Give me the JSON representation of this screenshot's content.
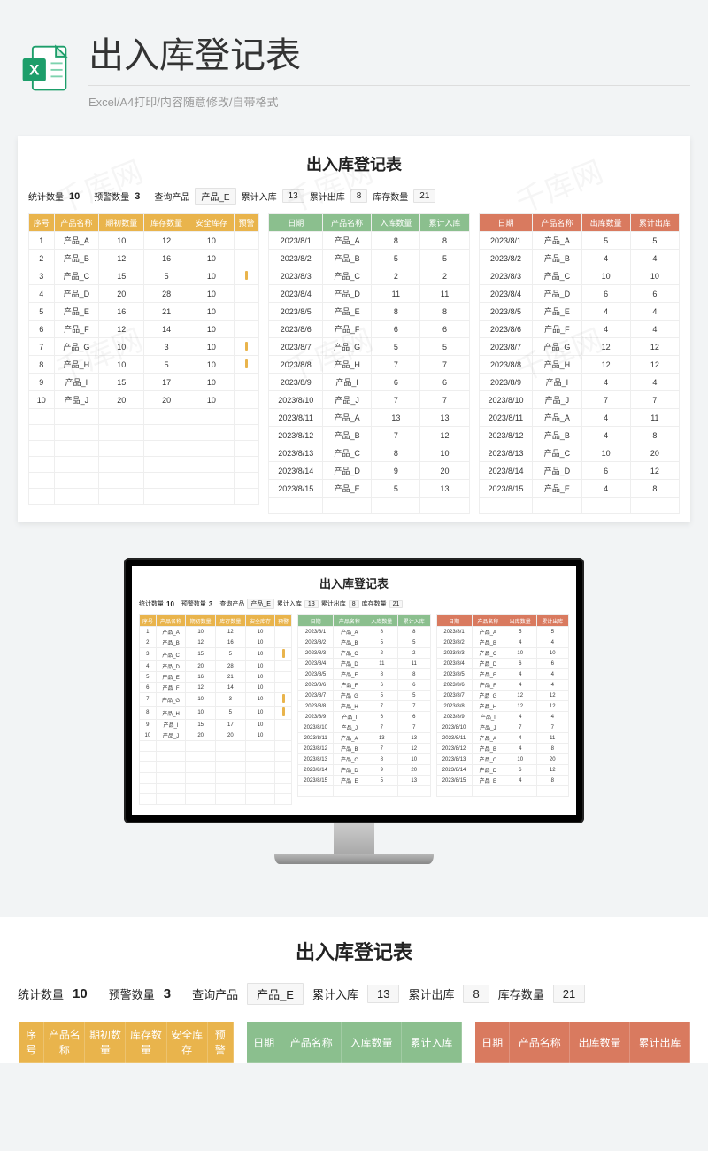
{
  "page": {
    "title": "出入库登记表",
    "subtitle": "Excel/A4打印/内容随意修改/自带格式",
    "watermark": "千库网"
  },
  "sheet": {
    "title": "出入库登记表",
    "stats": {
      "count_label": "统计数量",
      "count_val": "10",
      "warn_label": "预警数量",
      "warn_val": "3",
      "query_label": "查询产品",
      "query_val": "产品_E",
      "in_label": "累计入库",
      "in_val": "13",
      "out_label": "累计出库",
      "out_val": "8",
      "stock_label": "库存数量",
      "stock_val": "21"
    },
    "t1_headers": [
      "序号",
      "产品名称",
      "期初数量",
      "库存数量",
      "安全库存",
      "预警"
    ],
    "t2_headers": [
      "日期",
      "产品名称",
      "入库数量",
      "累计入库"
    ],
    "t3_headers": [
      "日期",
      "产品名称",
      "出库数量",
      "累计出库"
    ],
    "t1_rows": [
      [
        "1",
        "产品_A",
        "10",
        "12",
        "10",
        ""
      ],
      [
        "2",
        "产品_B",
        "12",
        "16",
        "10",
        ""
      ],
      [
        "3",
        "产品_C",
        "15",
        "5",
        "10",
        "!"
      ],
      [
        "4",
        "产品_D",
        "20",
        "28",
        "10",
        ""
      ],
      [
        "5",
        "产品_E",
        "16",
        "21",
        "10",
        ""
      ],
      [
        "6",
        "产品_F",
        "12",
        "14",
        "10",
        ""
      ],
      [
        "7",
        "产品_G",
        "10",
        "3",
        "10",
        "!"
      ],
      [
        "8",
        "产品_H",
        "10",
        "5",
        "10",
        "!"
      ],
      [
        "9",
        "产品_I",
        "15",
        "17",
        "10",
        ""
      ],
      [
        "10",
        "产品_J",
        "20",
        "20",
        "10",
        ""
      ]
    ],
    "t2_rows": [
      [
        "2023/8/1",
        "产品_A",
        "8",
        "8"
      ],
      [
        "2023/8/2",
        "产品_B",
        "5",
        "5"
      ],
      [
        "2023/8/3",
        "产品_C",
        "2",
        "2"
      ],
      [
        "2023/8/4",
        "产品_D",
        "11",
        "11"
      ],
      [
        "2023/8/5",
        "产品_E",
        "8",
        "8"
      ],
      [
        "2023/8/6",
        "产品_F",
        "6",
        "6"
      ],
      [
        "2023/8/7",
        "产品_G",
        "5",
        "5"
      ],
      [
        "2023/8/8",
        "产品_H",
        "7",
        "7"
      ],
      [
        "2023/8/9",
        "产品_I",
        "6",
        "6"
      ],
      [
        "2023/8/10",
        "产品_J",
        "7",
        "7"
      ],
      [
        "2023/8/11",
        "产品_A",
        "13",
        "13"
      ],
      [
        "2023/8/12",
        "产品_B",
        "7",
        "12"
      ],
      [
        "2023/8/13",
        "产品_C",
        "8",
        "10"
      ],
      [
        "2023/8/14",
        "产品_D",
        "9",
        "20"
      ],
      [
        "2023/8/15",
        "产品_E",
        "5",
        "13"
      ]
    ],
    "t3_rows": [
      [
        "2023/8/1",
        "产品_A",
        "5",
        "5"
      ],
      [
        "2023/8/2",
        "产品_B",
        "4",
        "4"
      ],
      [
        "2023/8/3",
        "产品_C",
        "10",
        "10"
      ],
      [
        "2023/8/4",
        "产品_D",
        "6",
        "6"
      ],
      [
        "2023/8/5",
        "产品_E",
        "4",
        "4"
      ],
      [
        "2023/8/6",
        "产品_F",
        "4",
        "4"
      ],
      [
        "2023/8/7",
        "产品_G",
        "12",
        "12"
      ],
      [
        "2023/8/8",
        "产品_H",
        "12",
        "12"
      ],
      [
        "2023/8/9",
        "产品_I",
        "4",
        "4"
      ],
      [
        "2023/8/10",
        "产品_J",
        "7",
        "7"
      ],
      [
        "2023/8/11",
        "产品_A",
        "4",
        "11"
      ],
      [
        "2023/8/12",
        "产品_B",
        "4",
        "8"
      ],
      [
        "2023/8/13",
        "产品_C",
        "10",
        "20"
      ],
      [
        "2023/8/14",
        "产品_D",
        "6",
        "12"
      ],
      [
        "2023/8/15",
        "产品_E",
        "4",
        "8"
      ]
    ]
  }
}
